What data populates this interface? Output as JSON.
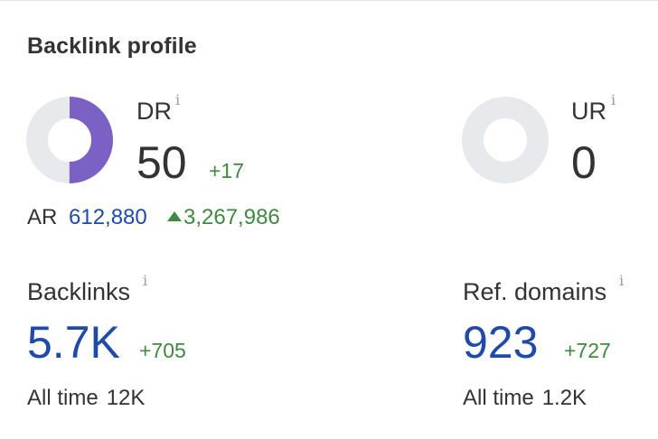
{
  "card": {
    "title": "Backlink profile"
  },
  "dr": {
    "label": "DR",
    "info": "i",
    "value": "50",
    "delta": "+17",
    "gauge_fraction": 0.5,
    "gauge_color": "#7b61c4",
    "track_color": "#e8e9ec"
  },
  "ur": {
    "label": "UR",
    "info": "i",
    "value": "0",
    "gauge_fraction": 0
  },
  "ar": {
    "label": "AR",
    "value": "612,880",
    "icon": "triangle-up-icon",
    "delta": "3,267,986"
  },
  "backlinks": {
    "label": "Backlinks",
    "info": "i",
    "value": "5.7K",
    "delta": "+705",
    "all_time_label": "All time",
    "all_time_value": "12K"
  },
  "ref_domains": {
    "label": "Ref. domains",
    "info": "i",
    "value": "923",
    "delta": "+727",
    "all_time_label": "All time",
    "all_time_value": "1.2K"
  }
}
